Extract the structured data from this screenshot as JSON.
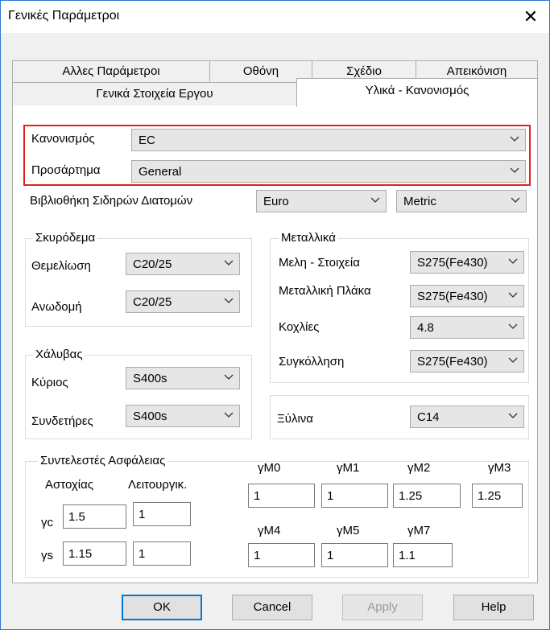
{
  "window": {
    "title": "Γενικές Παράμετροι",
    "close_glyph": "✕"
  },
  "tabs": {
    "row1": [
      "Αλλες Παράμετροι",
      "Οθόνη",
      "Σχέδιο",
      "Απεικόνιση"
    ],
    "row2": [
      "Γενικά Στοιχεία Εργου",
      "Υλικά - Κανονισμός"
    ]
  },
  "regulation": {
    "kanonismos_label": "Κανονισμός",
    "kanonismos_value": "EC",
    "prosartima_label": "Προσάρτημα",
    "prosartima_value": "General",
    "library_label": "Βιβλιοθήκη Σιδηρών Διατομών",
    "library_value": "Euro",
    "units_value": "Metric"
  },
  "concrete": {
    "title": "Σκυρόδεμα",
    "foundation_label": "Θεμελίωση",
    "foundation_value": "C20/25",
    "superstructure_label": "Ανωδομή",
    "superstructure_value": "C20/25"
  },
  "steel": {
    "title": "Χάλυβας",
    "main_label": "Κύριος",
    "main_value": "S400s",
    "stirrups_label": "Συνδετήρες",
    "stirrups_value": "S400s"
  },
  "metals": {
    "title": "Μεταλλικά",
    "members_label": "Μελη - Στοιχεία",
    "members_value": "S275(Fe430)",
    "plate_label": "Μεταλλική Πλάκα",
    "plate_value": "S275(Fe430)",
    "bolts_label": "Κοχλίες",
    "bolts_value": "4.8",
    "welding_label": "Συγκόλληση",
    "welding_value": "S275(Fe430)"
  },
  "wood": {
    "label": "Ξύλινα",
    "value": "C14"
  },
  "safety": {
    "title": "Συντελεστές Ασφάλειας",
    "col_failure": "Αστοχίας",
    "col_service": "Λειτουργικ.",
    "gc_label": "γc",
    "gc_failure": "1.5",
    "gc_service": "1",
    "gs_label": "γs",
    "gs_failure": "1.15",
    "gs_service": "1",
    "gm0_label": "γM0",
    "gm0": "1",
    "gm1_label": "γM1",
    "gm1": "1",
    "gm2_label": "γM2",
    "gm2": "1.25",
    "gm3_label": "γM3",
    "gm3": "1.25",
    "gm4_label": "γM4",
    "gm4": "1",
    "gm5_label": "γM5",
    "gm5": "1",
    "gm7_label": "γM7",
    "gm7": "1.1"
  },
  "buttons": {
    "ok": "OK",
    "cancel": "Cancel",
    "apply": "Apply",
    "help": "Help"
  },
  "colors": {
    "highlight": "#e02020",
    "default_button_border": "#0078d7"
  },
  "icons": {
    "dropdown": "chevron-down-icon",
    "close": "close-icon"
  }
}
